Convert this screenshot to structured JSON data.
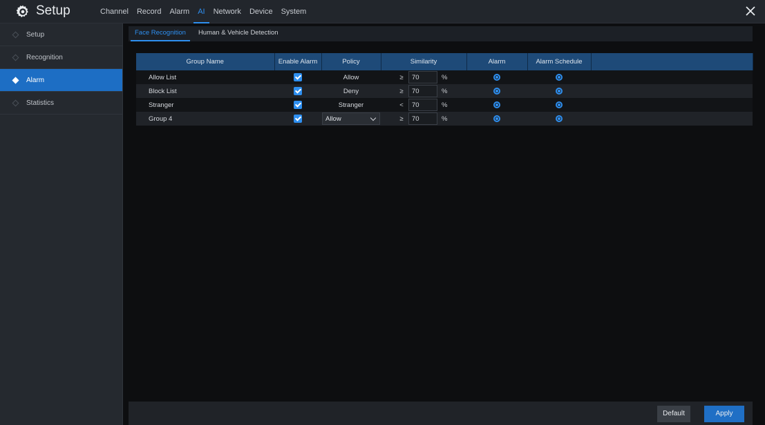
{
  "header": {
    "title": "Setup",
    "menu": [
      "Channel",
      "Record",
      "Alarm",
      "AI",
      "Network",
      "Device",
      "System"
    ],
    "active_menu": "AI"
  },
  "sidebar": {
    "items": [
      {
        "label": "Setup",
        "active": false
      },
      {
        "label": "Recognition",
        "active": false
      },
      {
        "label": "Alarm",
        "active": true
      },
      {
        "label": "Statistics",
        "active": false
      }
    ]
  },
  "subtabs": [
    {
      "label": "Face Recognition",
      "active": true
    },
    {
      "label": "Human & Vehicle Detection",
      "active": false
    }
  ],
  "table": {
    "headers": [
      "Group Name",
      "Enable Alarm",
      "Policy",
      "Similarity",
      "Alarm",
      "Alarm Schedule"
    ],
    "rows": [
      {
        "group": "Allow List",
        "enabled": true,
        "policy": "Allow",
        "operator": "≥",
        "similarity": "70",
        "unit": "%"
      },
      {
        "group": "Block List",
        "enabled": true,
        "policy": "Deny",
        "operator": "≥",
        "similarity": "70",
        "unit": "%"
      },
      {
        "group": "Stranger",
        "enabled": true,
        "policy": "Stranger",
        "operator": "<",
        "similarity": "70",
        "unit": "%"
      },
      {
        "group": "Group 4",
        "enabled": true,
        "policy": "Allow",
        "operator": "≥",
        "similarity": "70",
        "unit": "%"
      }
    ]
  },
  "footer": {
    "default_label": "Default",
    "apply_label": "Apply"
  },
  "colors": {
    "accent": "#2e8ff0",
    "header_row": "#1e4a78",
    "sidebar_active": "#1d6ec4"
  }
}
